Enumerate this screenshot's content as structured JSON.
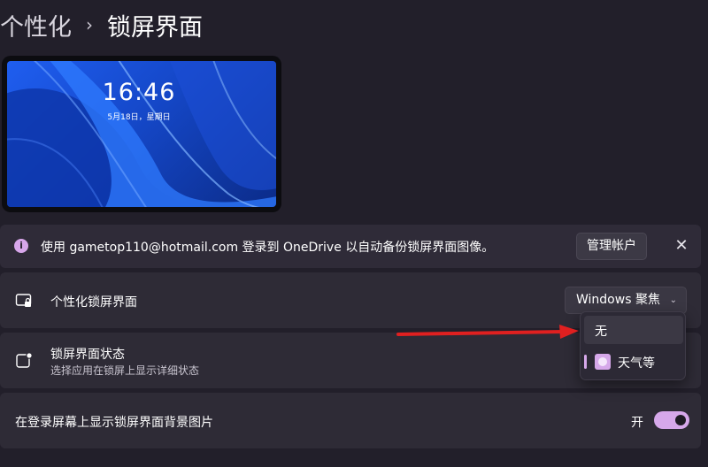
{
  "breadcrumb": {
    "parent": "个性化",
    "separator": "›",
    "current": "锁屏界面"
  },
  "preview": {
    "time": "16:46",
    "date": "5月18日，星期日"
  },
  "info_bar": {
    "icon": "info-icon",
    "icon_glyph": "i",
    "message": "使用 gametop110@hotmail.com 登录到 OneDrive 以自动备份锁屏界面图像。",
    "manage_button": "管理帐户",
    "close_glyph": "✕"
  },
  "personalize_lock_screen": {
    "icon": "lock-screen-icon",
    "label": "个性化锁屏界面",
    "selected_value": "Windows 聚焦",
    "chevron": "⌄"
  },
  "dropdown": {
    "options": [
      "无",
      "天气等"
    ]
  },
  "lock_screen_status": {
    "icon": "status-icon",
    "label": "锁屏界面状态",
    "description": "选择应用在锁屏上显示详细状态"
  },
  "signin_background": {
    "label": "在登录屏幕上显示锁屏界面背景图片",
    "toggle_state_label": "开",
    "toggle_on": true
  },
  "colors": {
    "background": "#221f2a",
    "card": "#2e2b36",
    "accent": "#d6a8ea",
    "annotation_arrow": "#e02020"
  }
}
